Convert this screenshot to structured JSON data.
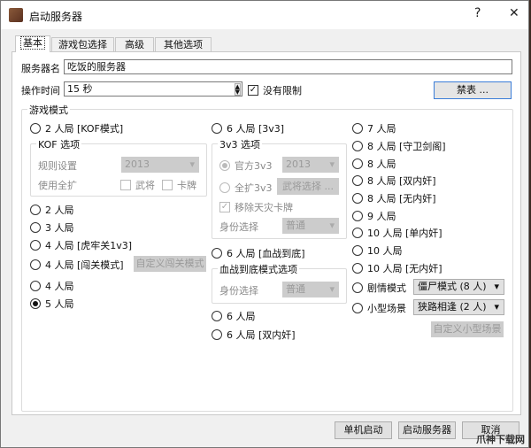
{
  "window": {
    "title": "启动服务器",
    "help": "?",
    "close": "✕"
  },
  "tabs": [
    "基本",
    "游戏包选择",
    "高级",
    "其他选项"
  ],
  "server_name": {
    "label": "服务器名",
    "value": "吃饭的服务器"
  },
  "op_time": {
    "label": "操作时间",
    "value": "15 秒",
    "no_limit_label": "没有限制",
    "no_limit_checked": true
  },
  "ban_button": "禁表 ...",
  "mode_group": "游戏模式",
  "kof": {
    "radio": "2 人局 [KOF模式]",
    "group": "KOF 选项",
    "rule_label": "规则设置",
    "rule_value": "2013",
    "expand_label": "使用全扩",
    "general": "武将",
    "card": "卡牌"
  },
  "col1": [
    "2 人局",
    "3 人局",
    "4 人局 [虎牢关1v3]",
    "4 人局 [闯关模式]",
    "4 人局",
    "5 人局"
  ],
  "custom_pass": "自定义闯关模式",
  "v3": {
    "radio": "6 人局 [3v3]",
    "group": "3v3 选项",
    "official": "官方3v3",
    "official_value": "2013",
    "full": "全扩3v3",
    "select_general": "武将选择 ...",
    "remove": "移除天灾卡牌",
    "identity_label": "身份选择",
    "identity_value": "普通"
  },
  "bloody": {
    "radio": "6 人局 [血战到底]",
    "group": "血战到底模式选项",
    "identity_label": "身份选择",
    "identity_value": "普通"
  },
  "col2_extra": [
    "6 人局",
    "6 人局 [双内奸]"
  ],
  "col3": [
    "7 人局",
    "8 人局 [守卫剑阁]",
    "8 人局",
    "8 人局 [双内奸]",
    "8 人局 [无内奸]",
    "9 人局",
    "10 人局 [单内奸]",
    "10 人局",
    "10 人局 [无内奸]"
  ],
  "story": {
    "label": "剧情模式",
    "value": "僵尸模式 (8 人)"
  },
  "mini": {
    "label": "小型场景",
    "value": "狭路相逢 (2 人)",
    "custom": "自定义小型场景"
  },
  "selected_mode": "5 人局",
  "buttons": {
    "single": "单机启动",
    "start": "启动服务器",
    "cancel": "取消"
  },
  "watermark": "爪神下载网"
}
